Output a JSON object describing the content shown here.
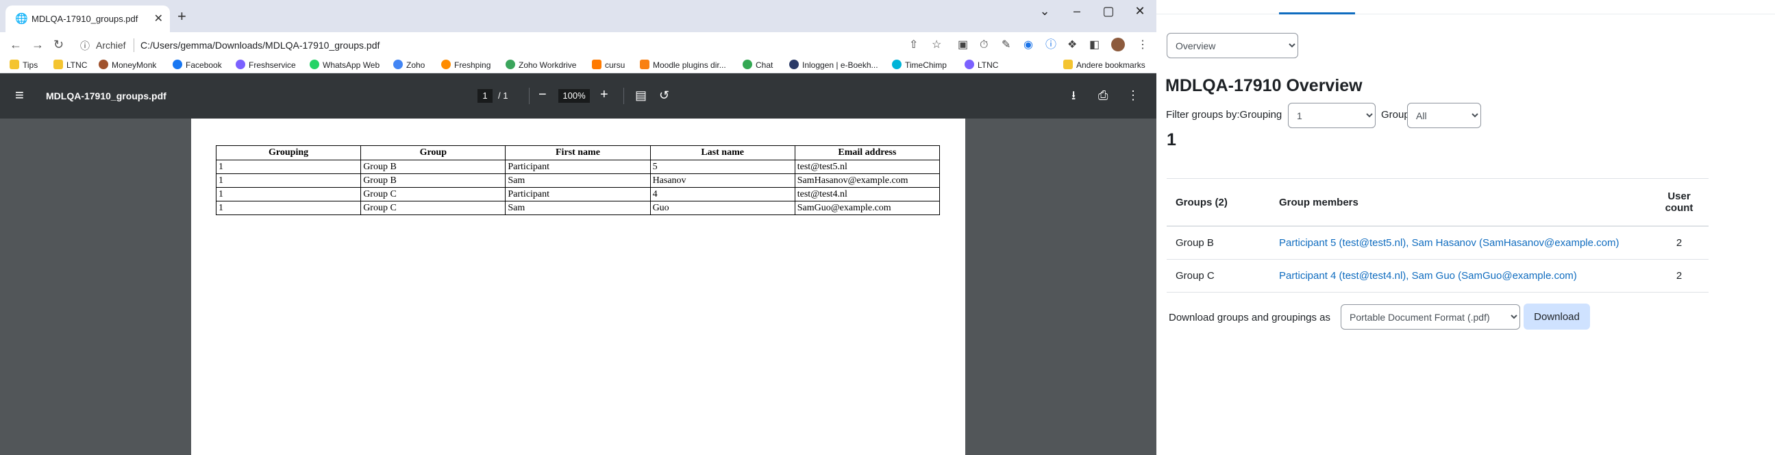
{
  "browser": {
    "tab_title": "MDLQA-17910_groups.pdf",
    "archief_label": "Archief",
    "url": "C:/Users/gemma/Downloads/MDLQA-17910_groups.pdf",
    "bookmarks": [
      "Tips",
      "LTNC",
      "MoneyMonk",
      "Facebook",
      "Freshservice",
      "WhatsApp Web",
      "Zoho",
      "Freshping",
      "Zoho Workdrive",
      "cursu",
      "Moodle plugins dir...",
      "Chat",
      "Inloggen | e-Boekh...",
      "TimeChimp",
      "LTNC",
      "Andere bookmarks"
    ]
  },
  "pdf_viewer": {
    "doc_name": "MDLQA-17910_groups.pdf",
    "page_current": "1",
    "page_total": "/ 1",
    "zoom": "100%",
    "table": {
      "headers": [
        "Grouping",
        "Group",
        "First name",
        "Last name",
        "Email address"
      ],
      "rows": [
        [
          "1",
          "Group B",
          "Participant",
          "5",
          "test@test5.nl"
        ],
        [
          "1",
          "Group B",
          "Sam",
          "Hasanov",
          "SamHasanov@example.com"
        ],
        [
          "1",
          "Group C",
          "Participant",
          "4",
          "test@test4.nl"
        ],
        [
          "1",
          "Group C",
          "Sam",
          "Guo",
          "SamGuo@example.com"
        ]
      ]
    }
  },
  "moodle": {
    "view_select": "Overview",
    "title": "MDLQA-17910 Overview",
    "filter_label": "Filter groups by:Grouping",
    "grouping_value": "1",
    "group_label": "Group",
    "group_value": "All",
    "grouping_heading": "1",
    "table": {
      "col_groups": "Groups (2)",
      "col_members": "Group members",
      "col_count_line1": "User",
      "col_count_line2": "count",
      "rows": [
        {
          "group": "Group B",
          "members": "Participant 5 (test@test5.nl), Sam Hasanov (SamHasanov@example.com)",
          "count": "2"
        },
        {
          "group": "Group C",
          "members": "Participant 4 (test@test4.nl), Sam Guo (SamGuo@example.com)",
          "count": "2"
        }
      ]
    },
    "download_label": "Download groups and groupings as",
    "download_format": "Portable Document Format (.pdf)",
    "download_button": "Download"
  }
}
